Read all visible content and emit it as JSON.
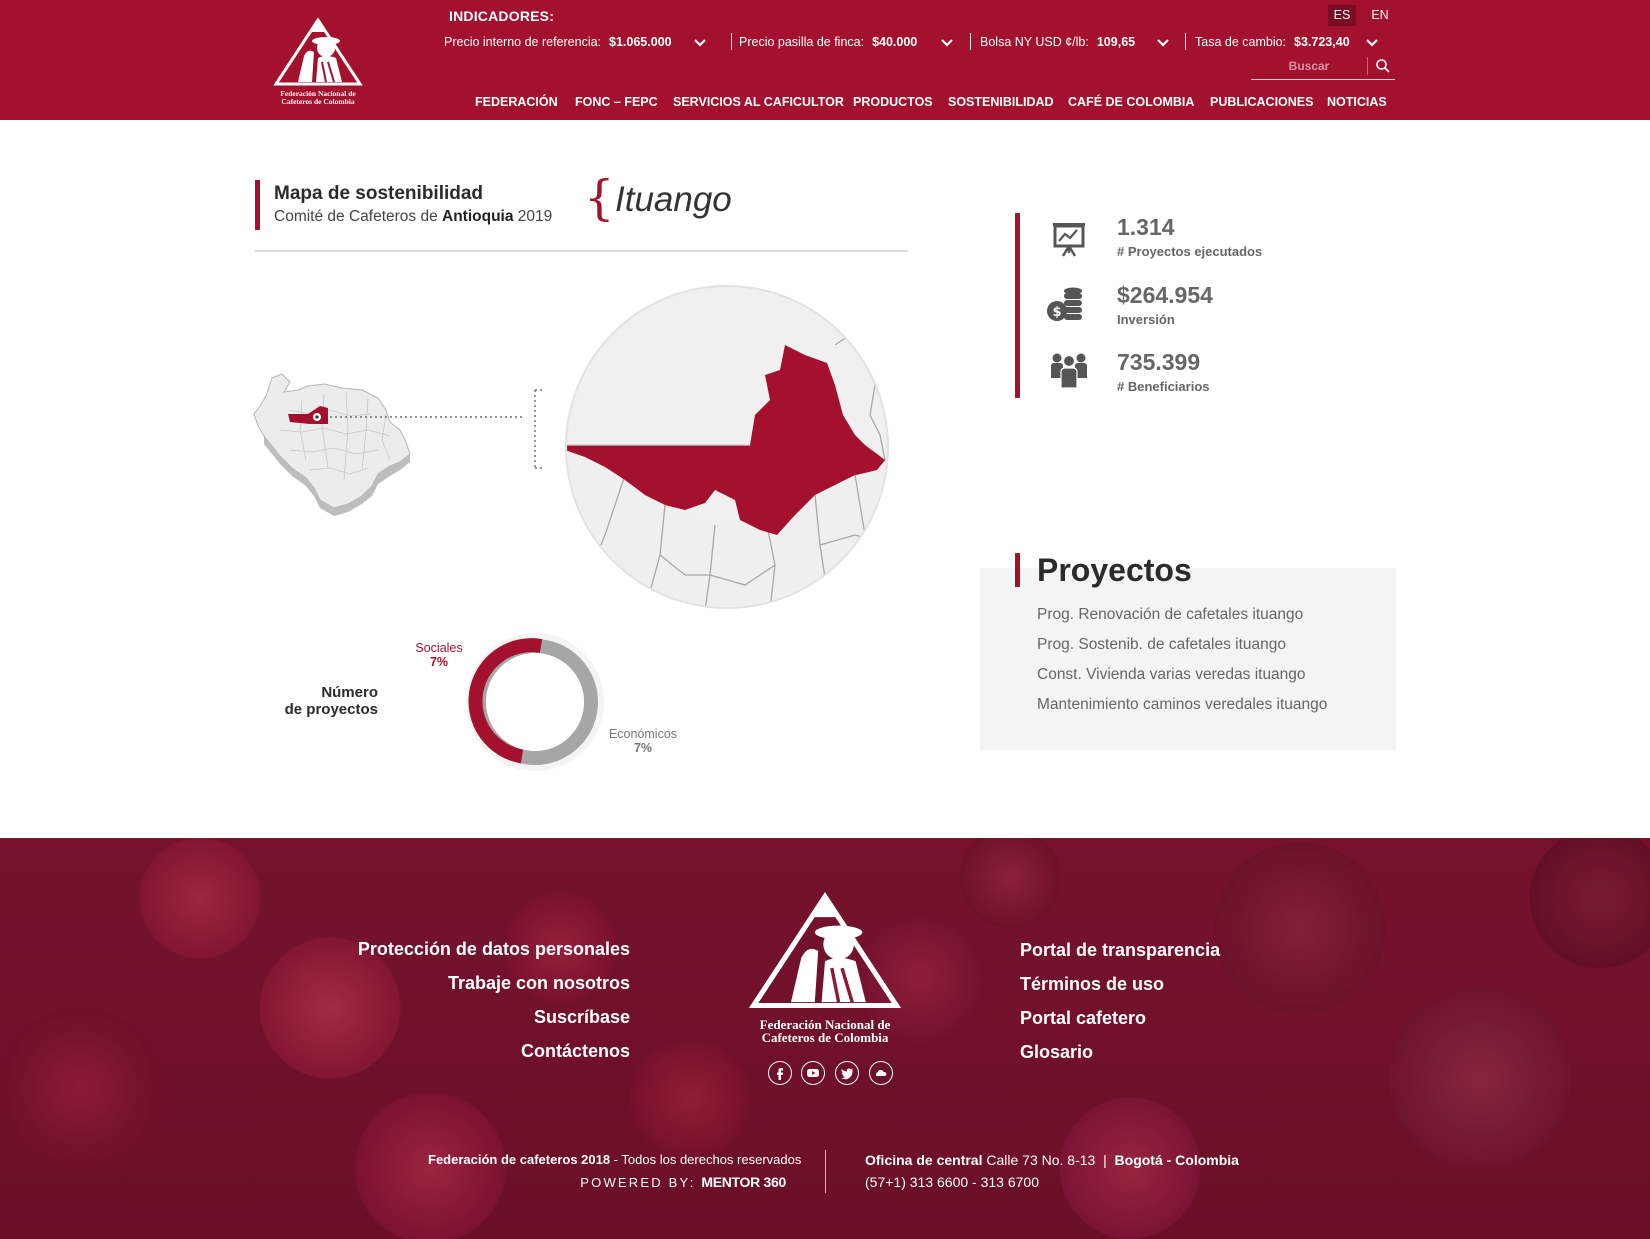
{
  "brand": {
    "logo_line1": "Federación Nacional de",
    "logo_line2": "Cafeteros de Colombia",
    "primary_color": "#a3112e"
  },
  "indicators": {
    "title": "INDICADORES:",
    "items": [
      {
        "label": "Precio interno de referencia:",
        "value": "$1.065.000"
      },
      {
        "label": "Precio pasilla de finca:",
        "value": "$40.000"
      },
      {
        "label": "Bolsa NY USD ¢/lb:",
        "value": "109,65"
      },
      {
        "label": "Tasa de cambio:",
        "value": "$3.723,40"
      }
    ]
  },
  "languages": {
    "es": "ES",
    "en": "EN",
    "active": "ES"
  },
  "search": {
    "placeholder": "Buscar",
    "icon": "search-icon"
  },
  "nav": [
    "FEDERACIÓN",
    "FONC – FEPC",
    "SERVICIOS AL CAFICULTOR",
    "PRODUCTOS",
    "SOSTENIBILIDAD",
    "CAFÉ DE COLOMBIA",
    "PUBLICACIONES",
    "NOTICIAS"
  ],
  "page": {
    "title": "Mapa de sostenibilidad",
    "subtitle_prefix": "Comité de Cafeteros de",
    "department": "Antioquia",
    "year": "2019",
    "brace": "{",
    "municipality": "Ituango"
  },
  "donut": {
    "label_line1": "Número",
    "label_line2": "de proyectos",
    "segments": [
      {
        "name": "Sociales",
        "value": "7%",
        "color": "#a3112e"
      },
      {
        "name": "Económicos",
        "value": "7%",
        "color": "#a6a6a6"
      }
    ]
  },
  "stats": [
    {
      "value": "1.314",
      "label": "# Proyectos ejecutados",
      "icon": "presentation-chart-icon"
    },
    {
      "value": "$264.954",
      "label": "Inversión",
      "icon": "coins-icon"
    },
    {
      "value": "735.399",
      "label": "# Beneficiarios",
      "icon": "people-icon"
    }
  ],
  "projects": {
    "title": "Proyectos",
    "items": [
      "Prog. Renovación de cafetales ituango",
      "Prog. Sostenib. de cafetales ituango",
      "Const. Vivienda varias veredas ituango",
      "Mantenimiento caminos veredales ituango"
    ]
  },
  "footer": {
    "left_links": [
      "Protección de datos personales",
      "Trabaje con nosotros",
      "Suscríbase",
      "Contáctenos"
    ],
    "right_links": [
      "Portal de transparencia",
      "Términos de uso",
      "Portal cafetero",
      "Glosario"
    ],
    "social": [
      "facebook-icon",
      "youtube-icon",
      "twitter-icon",
      "soundcloud-icon"
    ],
    "copyright_bold": "Federación de cafeteros 2018",
    "copyright_rest": " - Todos los derechos reservados",
    "powered_label": "POWERED BY:",
    "powered_brand": "MENTOR 360",
    "office_label": "Oficina de central",
    "office_address": " Calle 73 No. 8-13",
    "office_city": "Bogotá - Colombia",
    "phones": "(57+1) 313 6600 - 313 6700"
  }
}
